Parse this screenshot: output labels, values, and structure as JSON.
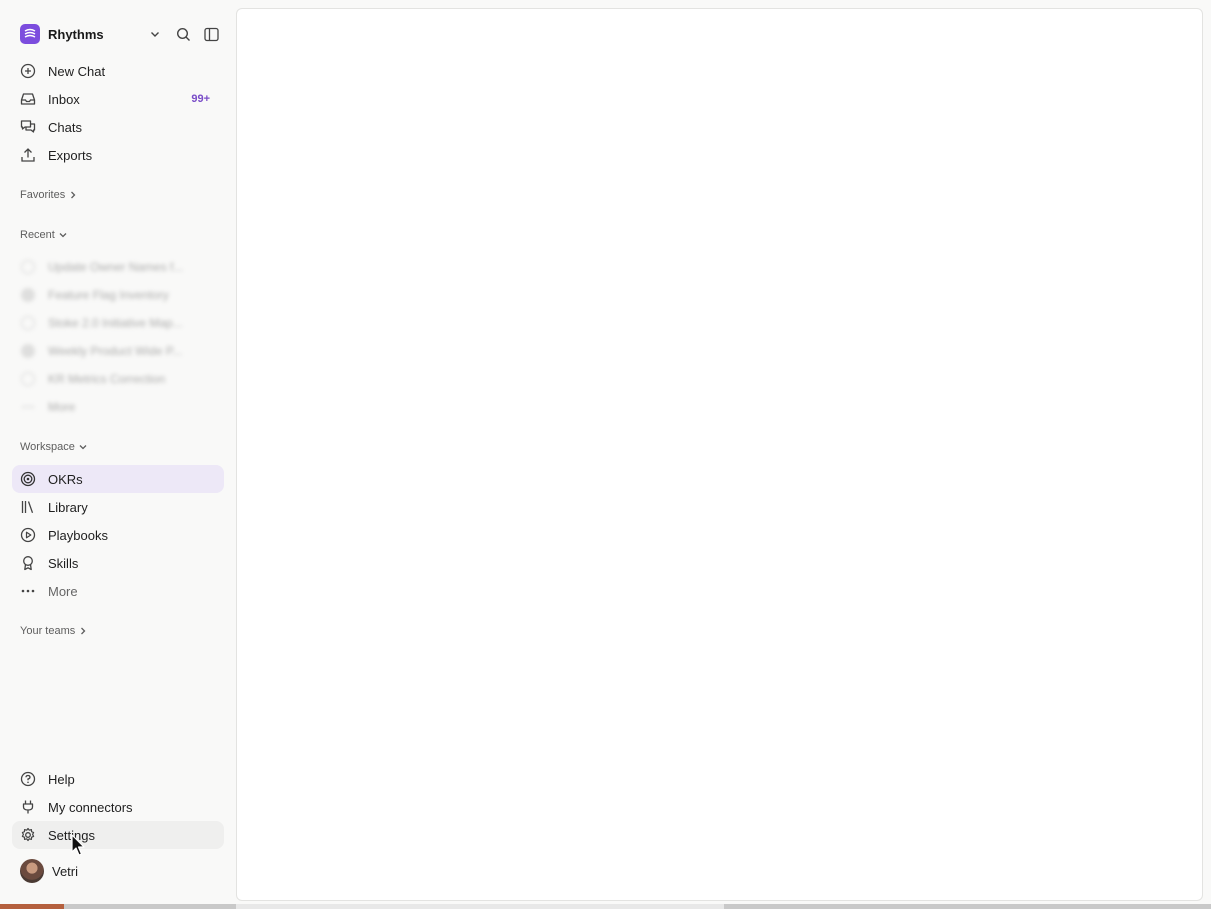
{
  "workspace": {
    "name": "Rhythms",
    "logo_icon": "rhythms-logo-icon"
  },
  "nav": {
    "new_chat": "New Chat",
    "inbox": "Inbox",
    "inbox_badge": "99+",
    "chats": "Chats",
    "exports": "Exports"
  },
  "sections": {
    "favorites": "Favorites",
    "recent": "Recent",
    "workspace": "Workspace",
    "your_teams": "Your teams"
  },
  "recent_items": [
    "Update Owner Names f...",
    "Feature Flag Inventory",
    "Stoke 2.0 Initiative Map...",
    "Weekly Product Wide P...",
    "KR Metrics Correction",
    "More"
  ],
  "workspace_items": {
    "okrs": "OKRs",
    "library": "Library",
    "playbooks": "Playbooks",
    "skills": "Skills",
    "more": "More"
  },
  "footer": {
    "help": "Help",
    "connectors": "My connectors",
    "settings": "Settings",
    "user": "Vetri"
  },
  "colors": {
    "accent": "#7c4dde",
    "active_bg": "#ede8f7",
    "badge": "#7a4dc8"
  }
}
